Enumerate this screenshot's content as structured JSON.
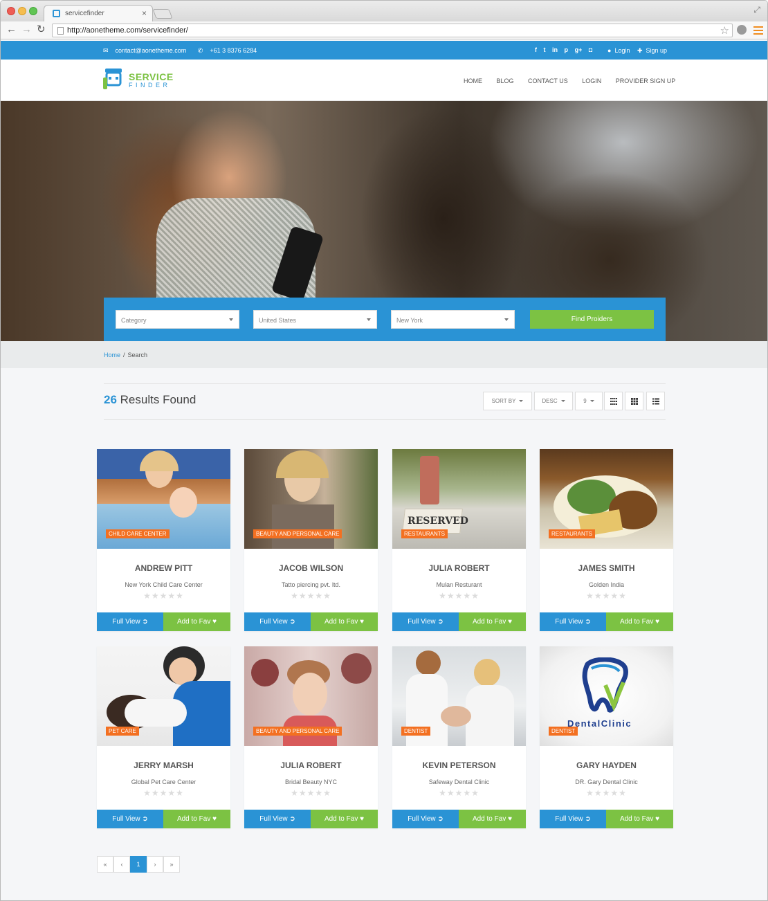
{
  "browser": {
    "tab_title": "servicefinder",
    "tab_close": "×",
    "url": "http://aonetheme.com/servicefinder/"
  },
  "topbar": {
    "email": "contact@aonetheme.com",
    "phone": "+61 3 8376 6284",
    "social_icons": [
      "facebook-icon",
      "twitter-icon",
      "linkedin-icon",
      "pinterest-icon",
      "google-plus-icon",
      "instagram-icon"
    ],
    "login": "Login",
    "signup": "Sign up"
  },
  "header": {
    "logo_line1": "SERVICE",
    "logo_line2": "FINDER",
    "nav": [
      "HOME",
      "BLOG",
      "CONTACT US",
      "LOGIN",
      "PROVIDER SIGN UP"
    ]
  },
  "search": {
    "category": "Category",
    "country": "United States",
    "city": "New York",
    "button": "Find Proiders"
  },
  "breadcrumb": {
    "home": "Home",
    "separator": "/",
    "current": "Search"
  },
  "results": {
    "count": "26",
    "label": "Results Found",
    "sort_by": "SORT BY",
    "order": "DESC",
    "per_page": "9"
  },
  "cards": [
    {
      "tag": "CHILD CARE CENTER",
      "name": "ANDREW PITT",
      "company": "New York Child Care Center",
      "rating": 0
    },
    {
      "tag": "BEAUTY AND PERSONAL CARE",
      "name": "JACOB WILSON",
      "company": "Tatto piercing pvt. ltd.",
      "rating": 0
    },
    {
      "tag": "RESTAURANTS",
      "name": "JULIA ROBERT",
      "company": "Mulan Resturant",
      "rating": 0
    },
    {
      "tag": "RESTAURANTS",
      "name": "JAMES SMITH",
      "company": "Golden India",
      "rating": 0
    },
    {
      "tag": "PET CARE",
      "name": "JERRY MARSH",
      "company": "Global Pet Care Center",
      "rating": 0
    },
    {
      "tag": "BEAUTY AND PERSONAL CARE",
      "name": "JULIA ROBERT",
      "company": "Bridal Beauty NYC",
      "rating": 0
    },
    {
      "tag": "DENTIST",
      "name": "KEVIN PETERSON",
      "company": "Safeway Dental Clinic",
      "rating": 0
    },
    {
      "tag": "DENTIST",
      "name": "GARY HAYDEN",
      "company": "DR. Gary Dental Clinic",
      "rating": 0
    }
  ],
  "card_actions": {
    "full_view": "Full View",
    "add_fav": "Add to Fav",
    "stars": "★★★★★"
  },
  "pagination": {
    "first": "«",
    "prev": "‹",
    "current": "1",
    "next": "›",
    "last": "»"
  },
  "dental_logo_text": "DentalClinic",
  "reserved_sign": "RESERVED",
  "colors": {
    "primary": "#2a93d5",
    "accent_green": "#7cc243",
    "tag_orange": "#f37021"
  }
}
